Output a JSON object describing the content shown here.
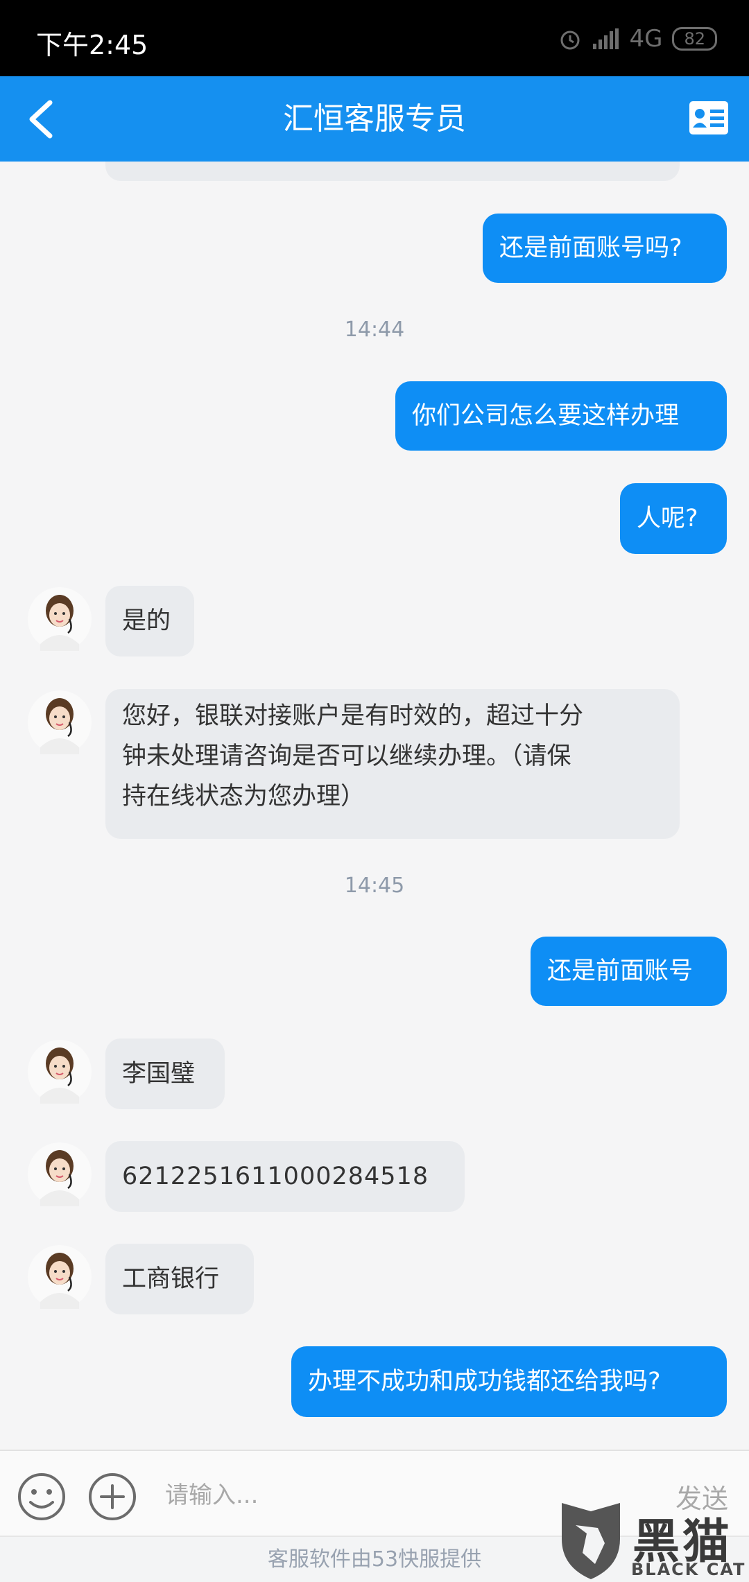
{
  "status_bar": {
    "time": "下午2:45",
    "network": "4G",
    "battery": "82"
  },
  "header": {
    "title": "汇恒客服专员"
  },
  "messages": [
    {
      "text": "还是前面账号吗?"
    },
    {
      "timestamp": "14:44"
    },
    {
      "text": "你们公司怎么要这样办理"
    },
    {
      "text": "人呢?"
    },
    {
      "text": "是的"
    },
    {
      "lines": [
        "您好，银联对接账户是有时效的，超过十分",
        "钟未处理请咨询是否可以继续办理。（请保",
        "持在线状态为您办理）"
      ]
    },
    {
      "timestamp": "14:45"
    },
    {
      "text": "还是前面账号"
    },
    {
      "text": "李国璧"
    },
    {
      "text": "6212251611000284518"
    },
    {
      "text": "工商银行"
    },
    {
      "text": "办理不成功和成功钱都还给我吗?"
    }
  ],
  "input": {
    "placeholder": "请输入...",
    "send_label": "发送"
  },
  "footer": {
    "text": "客服软件由53快服提供"
  },
  "watermark": {
    "text": "黑猫",
    "sub": "BLACK CAT"
  },
  "colors": {
    "accent": "#1590f0",
    "outgoing_bubble": "#0e8ef5",
    "incoming_bubble": "#e9ebee"
  }
}
